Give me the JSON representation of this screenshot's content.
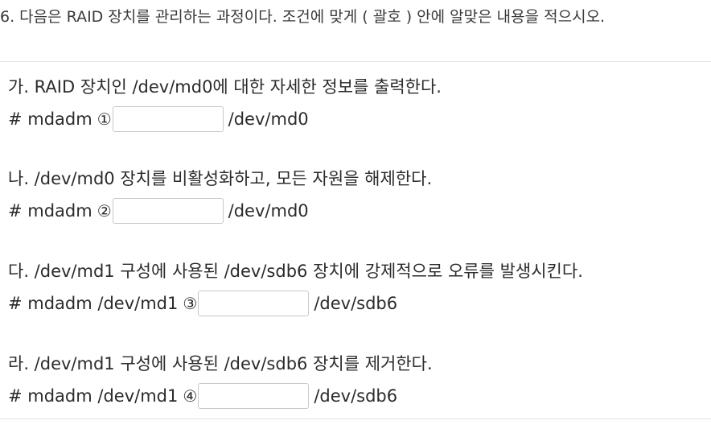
{
  "question": {
    "title": "6. 다음은 RAID 장치를 관리하는 과정이다. 조건에 맞게 ( 괄호 ) 안에 알맞은 내용을 적으시오.",
    "items": [
      {
        "description": "가. RAID 장치인 /dev/md0에 대한 자세한 정보를 출력한다.",
        "command_prefix": "# mdadm",
        "marker": "①",
        "answer_value": "",
        "command_suffix": "/dev/md0"
      },
      {
        "description": "나. /dev/md0 장치를 비활성화하고, 모든 자원을 해제한다.",
        "command_prefix": "# mdadm",
        "marker": "②",
        "answer_value": "",
        "command_suffix": "/dev/md0"
      },
      {
        "description": "다. /dev/md1 구성에 사용된 /dev/sdb6 장치에 강제적으로 오류를 발생시킨다.",
        "command_prefix": "# mdadm /dev/md1",
        "marker": "③",
        "answer_value": "",
        "command_suffix": "/dev/sdb6"
      },
      {
        "description": "라. /dev/md1 구성에 사용된 /dev/sdb6 장치를 제거한다.",
        "command_prefix": "# mdadm /dev/md1",
        "marker": "④",
        "answer_value": "",
        "command_suffix": "/dev/sdb6"
      }
    ]
  },
  "colors": {
    "text": "#2b2b2b",
    "divider": "#e3e3e3",
    "input_border": "#c8c8c8"
  }
}
